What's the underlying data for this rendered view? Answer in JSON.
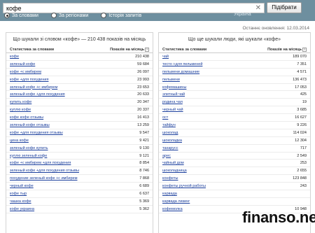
{
  "search": {
    "value": "кофе",
    "region": "Україна",
    "button_label": "Підібрати",
    "clear_icon": "close-icon"
  },
  "modes": [
    {
      "label": "За словами",
      "selected": true
    },
    {
      "label": "За регіонами",
      "selected": false
    },
    {
      "label": "Історія запитів",
      "selected": false
    }
  ],
  "updated": "Останнє оновлення: 12.03.2014",
  "left": {
    "title": "Що шукали зі словом «кофе» — 210 438 показів на місяць",
    "col_words": "Статистика за словами",
    "col_shows": "Показів на місяць",
    "rows": [
      {
        "phrase": "кофе",
        "count": "210 438"
      },
      {
        "phrase": "зеленый кофе",
        "count": "59 684"
      },
      {
        "phrase": "кофе +с имбирем",
        "count": "26 097"
      },
      {
        "phrase": "кофе +для похудения",
        "count": "23 993"
      },
      {
        "phrase": "зеленый кофе +с имбирем",
        "count": "23 653"
      },
      {
        "phrase": "зеленый кофе +для похудения",
        "count": "20 633"
      },
      {
        "phrase": "купить кофе",
        "count": "20 347"
      },
      {
        "phrase": "куплю кофе",
        "count": "20 337"
      },
      {
        "phrase": "кофе кофе отзывы",
        "count": "16 413"
      },
      {
        "phrase": "зеленый кофе отзывы",
        "count": "13 259"
      },
      {
        "phrase": "кофе +для похудения отзывы",
        "count": "9 547"
      },
      {
        "phrase": "цена кофе",
        "count": "9 421"
      },
      {
        "phrase": "зеленый кофе купить",
        "count": "9 130"
      },
      {
        "phrase": "куплю зеленый кофе",
        "count": "9 121"
      },
      {
        "phrase": "кофе +с имбирем +для похудения",
        "count": "8 854"
      },
      {
        "phrase": "зеленый кофе +для похудения отзывы",
        "count": "8 746"
      },
      {
        "phrase": "похудение зеленый кофе +с имбирем",
        "count": "7 868"
      },
      {
        "phrase": "черный кофе",
        "count": "6 689"
      },
      {
        "phrase": "кофе тыр",
        "count": "6 637"
      },
      {
        "phrase": "чашка кофе",
        "count": "5 369"
      },
      {
        "phrase": "кофе украина",
        "count": "5 362"
      }
    ]
  },
  "right": {
    "title": "Що ще шукали люди, які шукали «кофе»",
    "col_words": "Статистика за словами",
    "col_shows": "Показів на місяць",
    "rows": [
      {
        "phrase": "чай",
        "count": "189 070"
      },
      {
        "phrase": "тесто +для пельменей",
        "count": "7 351"
      },
      {
        "phrase": "пельмени домашние",
        "count": "4 571"
      },
      {
        "phrase": "пельмени",
        "count": "136 473"
      },
      {
        "phrase": "кофемашины",
        "count": "17 053"
      },
      {
        "phrase": "элитный чай",
        "count": "425"
      },
      {
        "phrase": "родина чая",
        "count": "19"
      },
      {
        "phrase": "черный чай",
        "count": "3 685"
      },
      {
        "phrase": "ост",
        "count": "16 627"
      },
      {
        "phrase": "тайфун",
        "count": "9 226"
      },
      {
        "phrase": "шоколад",
        "count": "114 024"
      },
      {
        "phrase": "шоколадка",
        "count": "12 304"
      },
      {
        "phrase": "тахарусс",
        "count": "717"
      },
      {
        "phrase": "арес",
        "count": "2 549"
      },
      {
        "phrase": "чайный дом",
        "count": "253"
      },
      {
        "phrase": "шоколадница",
        "count": "2 655"
      },
      {
        "phrase": "конфеты",
        "count": "123 848"
      },
      {
        "phrase": "конфеты ручной работы",
        "count": "243"
      },
      {
        "phrase": "карвада",
        "count": ""
      },
      {
        "phrase": "карвада лизинг",
        "count": ""
      },
      {
        "phrase": "кофемолка",
        "count": "10 948"
      }
    ]
  },
  "watermark": "finanso.net"
}
